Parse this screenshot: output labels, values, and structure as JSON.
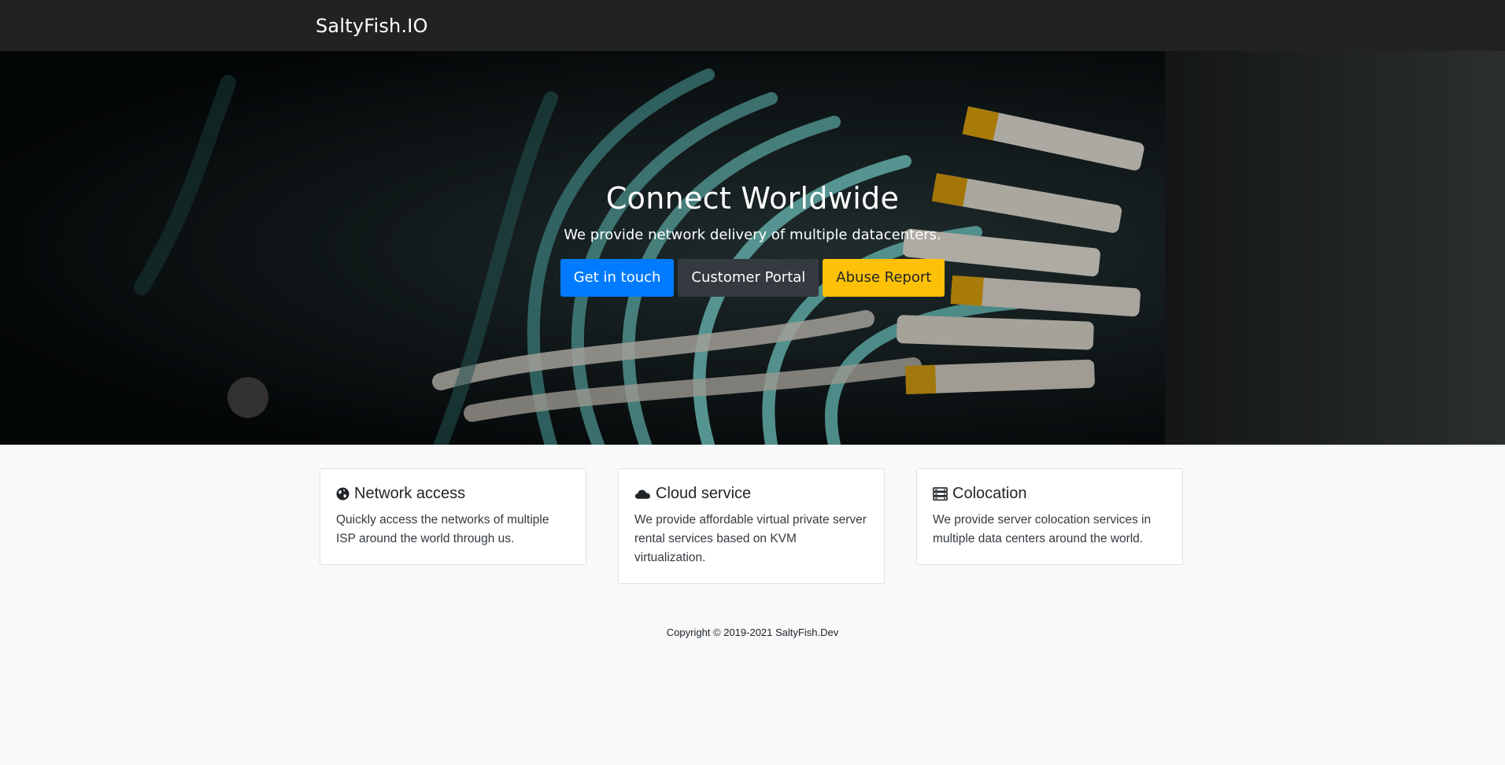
{
  "navbar": {
    "brand": "SaltyFish.IO"
  },
  "hero": {
    "title": "Connect Worldwide",
    "subtitle": "We provide network delivery of multiple datacenters.",
    "buttons": [
      {
        "label": "Get in touch",
        "color": "#007bff"
      },
      {
        "label": "Customer Portal",
        "color": "#343a40"
      },
      {
        "label": "Abuse Report",
        "color": "#ffc107"
      }
    ]
  },
  "features": [
    {
      "icon": "globe-icon",
      "title": "Network access",
      "text": "Quickly access the networks of multiple ISP around the world through us."
    },
    {
      "icon": "cloud-icon",
      "title": "Cloud service",
      "text": "We provide affordable virtual private server rental services based on KVM virtualization."
    },
    {
      "icon": "server-icon",
      "title": "Colocation",
      "text": "We provide server colocation services in multiple data centers around the world."
    }
  ],
  "footer": {
    "copyright": "Copyright © 2019-2021 SaltyFish.Dev"
  }
}
